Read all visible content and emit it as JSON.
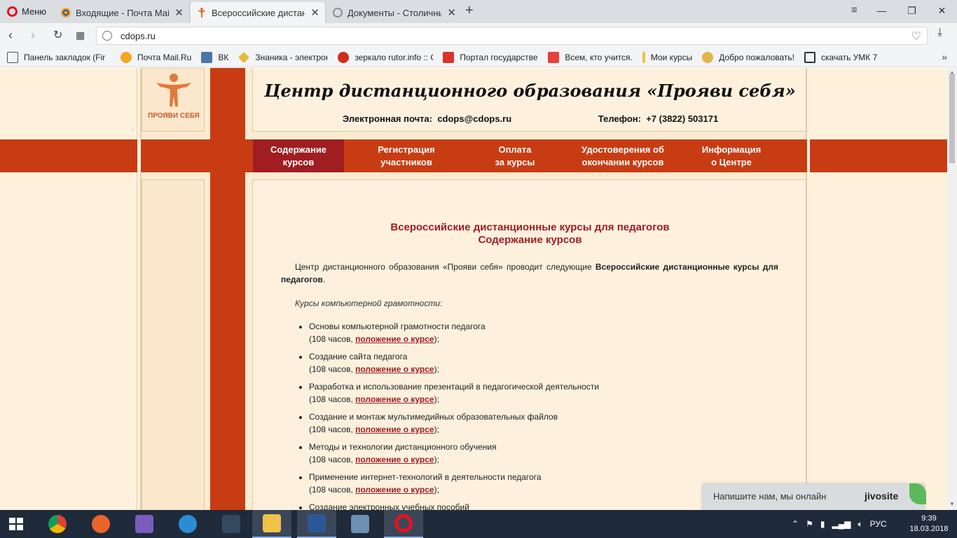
{
  "browser": {
    "menu_label": "Меню",
    "tabs": [
      {
        "title": "Входящие - Почта Mail.Ru",
        "active": false
      },
      {
        "title": "Всероссийские дистанционные",
        "active": true
      },
      {
        "title": "Документы - Столичный",
        "active": false
      }
    ],
    "url": "cdops.ru",
    "bookmarks": [
      {
        "label": "Панель закладок (Fir",
        "icon": "folder-icon"
      },
      {
        "label": "Почта Mail.Ru",
        "icon": "mailru-icon"
      },
      {
        "label": "ВК",
        "icon": "vk-icon"
      },
      {
        "label": "Знаника - электронн",
        "icon": "znanika-icon"
      },
      {
        "label": "зеркало rutor.info :: С",
        "icon": "rutor-icon"
      },
      {
        "label": "Портал государстве",
        "icon": "gosuslugi-icon"
      },
      {
        "label": "Всем, кто учится.",
        "icon": "ab-icon"
      },
      {
        "label": "Мои курсы",
        "icon": "courses-icon"
      },
      {
        "label": "Добро пожаловать!",
        "icon": "welcome-icon"
      },
      {
        "label": "скачать УМК 7",
        "icon": "umk-icon"
      }
    ]
  },
  "site": {
    "logo_text": "ПРОЯВИ СЕБЯ",
    "title": "Центр дистанционного образования «Прояви себя»",
    "email_label": "Электронная почта:",
    "email": "cdops@cdops.ru",
    "phone_label": "Телефон:",
    "phone": "+7 (3822) 503171",
    "menu": [
      {
        "line1": "Содержание",
        "line2": "курсов",
        "active": true
      },
      {
        "line1": "Регистрация",
        "line2": "участников",
        "active": false
      },
      {
        "line1": "Оплата",
        "line2": "за курсы",
        "active": false
      },
      {
        "line1": "Удостоверения об",
        "line2": "окончании курсов",
        "active": false
      },
      {
        "line1": "Информация",
        "line2": "о Центре",
        "active": false
      }
    ]
  },
  "content": {
    "heading_line1": "Всероссийские дистанционные курсы для педагогов",
    "heading_line2": "Содержание курсов",
    "intro_prefix": "Центр дистанционного образования «Прояви себя» проводит следующие ",
    "intro_bold": "Всероссийские дистанционные курсы для педагогов",
    "intro_suffix": ".",
    "section_title": "Курсы компьютерной грамотности:",
    "hours_prefix": "(108 часов, ",
    "link_label": "положение о курсе",
    "hours_suffix": ");",
    "courses": [
      "Основы компьютерной грамотности педагога",
      "Создание сайта педагога",
      "Разработка и использование презентаций в педагогической деятельности",
      "Создание и монтаж мультимедийных образовательных файлов",
      "Методы и технологии дистанционного обучения",
      "Применение интернет-технологий в деятельности педагога",
      "Создание электронных учебных пособий"
    ]
  },
  "chat_widget": {
    "text": "Напишите нам, мы онлайн",
    "brand": "jivosite"
  },
  "taskbar": {
    "language": "РУС",
    "time": "9:39",
    "date": "18.03.2018"
  },
  "colors": {
    "brand_red": "#c83c13",
    "active_menu": "#a01d21",
    "page_bg": "#fdf1dc"
  }
}
